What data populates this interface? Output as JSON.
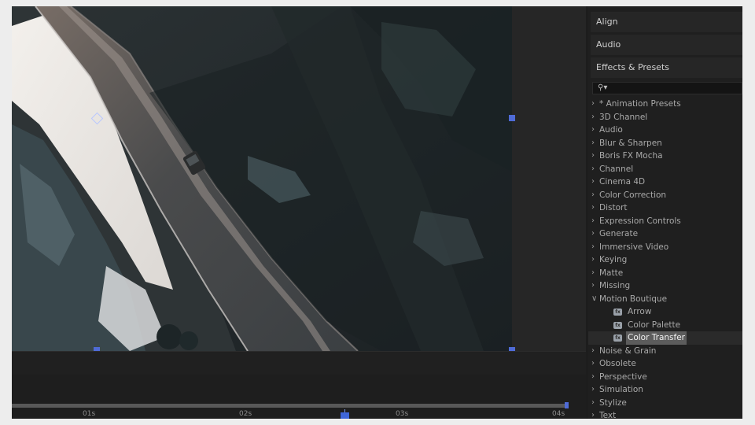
{
  "panels": {
    "align": "Align",
    "audio": "Audio",
    "effects_presets": "Effects & Presets"
  },
  "search": {
    "icon": "search-icon",
    "value": ""
  },
  "effects_tree": [
    {
      "label": "* Animation Presets",
      "expanded": false
    },
    {
      "label": "3D Channel",
      "expanded": false
    },
    {
      "label": "Audio",
      "expanded": false
    },
    {
      "label": "Blur & Sharpen",
      "expanded": false
    },
    {
      "label": "Boris FX Mocha",
      "expanded": false
    },
    {
      "label": "Channel",
      "expanded": false
    },
    {
      "label": "Cinema 4D",
      "expanded": false
    },
    {
      "label": "Color Correction",
      "expanded": false
    },
    {
      "label": "Distort",
      "expanded": false
    },
    {
      "label": "Expression Controls",
      "expanded": false
    },
    {
      "label": "Generate",
      "expanded": false
    },
    {
      "label": "Immersive Video",
      "expanded": false
    },
    {
      "label": "Keying",
      "expanded": false
    },
    {
      "label": "Matte",
      "expanded": false
    },
    {
      "label": "Missing",
      "expanded": false
    },
    {
      "label": "Motion Boutique",
      "expanded": true,
      "children": [
        {
          "label": "Arrow"
        },
        {
          "label": "Color Palette"
        },
        {
          "label": "Color Transfer",
          "selected": true
        }
      ]
    },
    {
      "label": "Noise & Grain",
      "expanded": false
    },
    {
      "label": "Obsolete",
      "expanded": false
    },
    {
      "label": "Perspective",
      "expanded": false
    },
    {
      "label": "Simulation",
      "expanded": false
    },
    {
      "label": "Stylize",
      "expanded": false
    },
    {
      "label": "Text",
      "expanded": false
    }
  ],
  "timeline": {
    "ticks": [
      "01s",
      "02s",
      "03s",
      "04s"
    ],
    "accent": "#4f6bd6"
  }
}
